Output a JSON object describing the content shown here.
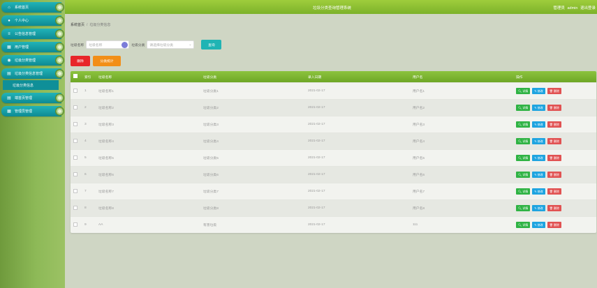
{
  "app": {
    "title": "垃圾分类查询管理系统",
    "admin_label": "管理员",
    "user": "admin",
    "logout": "退出登录"
  },
  "colors": {
    "sidebar_item": "#0e8a93",
    "topbar": "#7cb22a",
    "delete_button": "#e8262a",
    "stat_button": "#f28e17",
    "query_button": "#20b4b4"
  },
  "sidebar": {
    "items": [
      {
        "label": "系统首页",
        "icon": "home-icon"
      },
      {
        "label": "个人中心",
        "icon": "user-icon"
      },
      {
        "label": "公告信息管理",
        "icon": "list-icon"
      },
      {
        "label": "用户管理",
        "icon": "grid-icon"
      },
      {
        "label": "垃圾分类管理",
        "icon": "pin-icon"
      },
      {
        "label": "垃圾分类信息管理",
        "icon": "doc-icon"
      }
    ],
    "sub_item": "垃圾分类信息",
    "items_after": [
      {
        "label": "端首页管理",
        "icon": "doc-icon"
      },
      {
        "label": "管理员管理",
        "icon": "grid-icon"
      }
    ]
  },
  "breadcrumb": {
    "root": "系统首页",
    "current": "垃圾分类信息"
  },
  "search": {
    "name_label": "垃圾名称",
    "name_placeholder": "垃圾名称",
    "category_label": "垃圾分类",
    "category_placeholder": "请选择垃圾分类",
    "query_button": "查询"
  },
  "toolbar": {
    "delete_button": "删除",
    "stat_button": "分类统计"
  },
  "table": {
    "headers": [
      "索引",
      "垃圾名称",
      "垃圾分类",
      "录入日期",
      "用户名",
      "操作"
    ],
    "rows": [
      {
        "idx": "1",
        "name": "垃圾名称1",
        "cat": "垃圾分类1",
        "date": "2021-02-17",
        "user": "用户名1"
      },
      {
        "idx": "2",
        "name": "垃圾名称2",
        "cat": "垃圾分类2",
        "date": "2021-02-17",
        "user": "用户名2"
      },
      {
        "idx": "3",
        "name": "垃圾名称3",
        "cat": "垃圾分类3",
        "date": "2021-02-17",
        "user": "用户名3"
      },
      {
        "idx": "4",
        "name": "垃圾名称4",
        "cat": "垃圾分类4",
        "date": "2021-02-17",
        "user": "用户名4"
      },
      {
        "idx": "5",
        "name": "垃圾名称5",
        "cat": "垃圾分类5",
        "date": "2021-02-17",
        "user": "用户名5"
      },
      {
        "idx": "6",
        "name": "垃圾名称6",
        "cat": "垃圾分类6",
        "date": "2021-02-17",
        "user": "用户名6"
      },
      {
        "idx": "7",
        "name": "垃圾名称7",
        "cat": "垃圾分类7",
        "date": "2021-02-17",
        "user": "用户名7"
      },
      {
        "idx": "8",
        "name": "垃圾名称8",
        "cat": "垃圾分类8",
        "date": "2021-02-17",
        "user": "用户名8"
      },
      {
        "idx": "9",
        "name": "AA",
        "cat": "有害垃圾",
        "date": "2021-02-17",
        "user": "111"
      }
    ],
    "op_labels": {
      "view": "详情",
      "edit": "修改",
      "delete": "删除"
    }
  }
}
